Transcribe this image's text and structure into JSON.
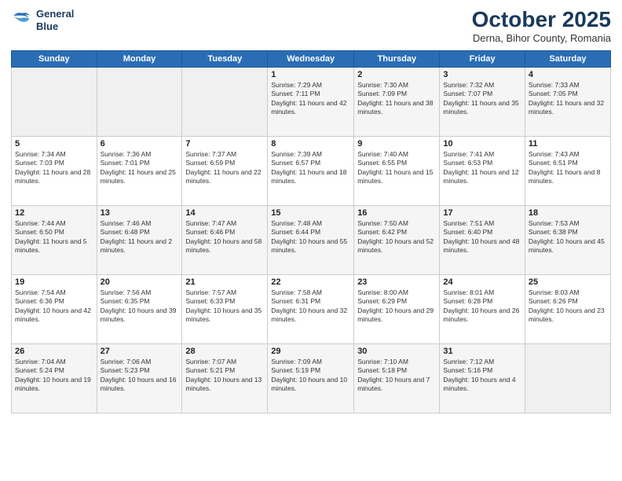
{
  "header": {
    "logo_line1": "General",
    "logo_line2": "Blue",
    "month": "October 2025",
    "location": "Derna, Bihor County, Romania"
  },
  "weekdays": [
    "Sunday",
    "Monday",
    "Tuesday",
    "Wednesday",
    "Thursday",
    "Friday",
    "Saturday"
  ],
  "weeks": [
    [
      {
        "day": "",
        "sunrise": "",
        "sunset": "",
        "daylight": ""
      },
      {
        "day": "",
        "sunrise": "",
        "sunset": "",
        "daylight": ""
      },
      {
        "day": "",
        "sunrise": "",
        "sunset": "",
        "daylight": ""
      },
      {
        "day": "1",
        "sunrise": "Sunrise: 7:29 AM",
        "sunset": "Sunset: 7:11 PM",
        "daylight": "Daylight: 11 hours and 42 minutes."
      },
      {
        "day": "2",
        "sunrise": "Sunrise: 7:30 AM",
        "sunset": "Sunset: 7:09 PM",
        "daylight": "Daylight: 11 hours and 38 minutes."
      },
      {
        "day": "3",
        "sunrise": "Sunrise: 7:32 AM",
        "sunset": "Sunset: 7:07 PM",
        "daylight": "Daylight: 11 hours and 35 minutes."
      },
      {
        "day": "4",
        "sunrise": "Sunrise: 7:33 AM",
        "sunset": "Sunset: 7:05 PM",
        "daylight": "Daylight: 11 hours and 32 minutes."
      }
    ],
    [
      {
        "day": "5",
        "sunrise": "Sunrise: 7:34 AM",
        "sunset": "Sunset: 7:03 PM",
        "daylight": "Daylight: 11 hours and 28 minutes."
      },
      {
        "day": "6",
        "sunrise": "Sunrise: 7:36 AM",
        "sunset": "Sunset: 7:01 PM",
        "daylight": "Daylight: 11 hours and 25 minutes."
      },
      {
        "day": "7",
        "sunrise": "Sunrise: 7:37 AM",
        "sunset": "Sunset: 6:59 PM",
        "daylight": "Daylight: 11 hours and 22 minutes."
      },
      {
        "day": "8",
        "sunrise": "Sunrise: 7:39 AM",
        "sunset": "Sunset: 6:57 PM",
        "daylight": "Daylight: 11 hours and 18 minutes."
      },
      {
        "day": "9",
        "sunrise": "Sunrise: 7:40 AM",
        "sunset": "Sunset: 6:55 PM",
        "daylight": "Daylight: 11 hours and 15 minutes."
      },
      {
        "day": "10",
        "sunrise": "Sunrise: 7:41 AM",
        "sunset": "Sunset: 6:53 PM",
        "daylight": "Daylight: 11 hours and 12 minutes."
      },
      {
        "day": "11",
        "sunrise": "Sunrise: 7:43 AM",
        "sunset": "Sunset: 6:51 PM",
        "daylight": "Daylight: 11 hours and 8 minutes."
      }
    ],
    [
      {
        "day": "12",
        "sunrise": "Sunrise: 7:44 AM",
        "sunset": "Sunset: 6:50 PM",
        "daylight": "Daylight: 11 hours and 5 minutes."
      },
      {
        "day": "13",
        "sunrise": "Sunrise: 7:46 AM",
        "sunset": "Sunset: 6:48 PM",
        "daylight": "Daylight: 11 hours and 2 minutes."
      },
      {
        "day": "14",
        "sunrise": "Sunrise: 7:47 AM",
        "sunset": "Sunset: 6:46 PM",
        "daylight": "Daylight: 10 hours and 58 minutes."
      },
      {
        "day": "15",
        "sunrise": "Sunrise: 7:48 AM",
        "sunset": "Sunset: 6:44 PM",
        "daylight": "Daylight: 10 hours and 55 minutes."
      },
      {
        "day": "16",
        "sunrise": "Sunrise: 7:50 AM",
        "sunset": "Sunset: 6:42 PM",
        "daylight": "Daylight: 10 hours and 52 minutes."
      },
      {
        "day": "17",
        "sunrise": "Sunrise: 7:51 AM",
        "sunset": "Sunset: 6:40 PM",
        "daylight": "Daylight: 10 hours and 48 minutes."
      },
      {
        "day": "18",
        "sunrise": "Sunrise: 7:53 AM",
        "sunset": "Sunset: 6:38 PM",
        "daylight": "Daylight: 10 hours and 45 minutes."
      }
    ],
    [
      {
        "day": "19",
        "sunrise": "Sunrise: 7:54 AM",
        "sunset": "Sunset: 6:36 PM",
        "daylight": "Daylight: 10 hours and 42 minutes."
      },
      {
        "day": "20",
        "sunrise": "Sunrise: 7:56 AM",
        "sunset": "Sunset: 6:35 PM",
        "daylight": "Daylight: 10 hours and 39 minutes."
      },
      {
        "day": "21",
        "sunrise": "Sunrise: 7:57 AM",
        "sunset": "Sunset: 6:33 PM",
        "daylight": "Daylight: 10 hours and 35 minutes."
      },
      {
        "day": "22",
        "sunrise": "Sunrise: 7:58 AM",
        "sunset": "Sunset: 6:31 PM",
        "daylight": "Daylight: 10 hours and 32 minutes."
      },
      {
        "day": "23",
        "sunrise": "Sunrise: 8:00 AM",
        "sunset": "Sunset: 6:29 PM",
        "daylight": "Daylight: 10 hours and 29 minutes."
      },
      {
        "day": "24",
        "sunrise": "Sunrise: 8:01 AM",
        "sunset": "Sunset: 6:28 PM",
        "daylight": "Daylight: 10 hours and 26 minutes."
      },
      {
        "day": "25",
        "sunrise": "Sunrise: 8:03 AM",
        "sunset": "Sunset: 6:26 PM",
        "daylight": "Daylight: 10 hours and 23 minutes."
      }
    ],
    [
      {
        "day": "26",
        "sunrise": "Sunrise: 7:04 AM",
        "sunset": "Sunset: 5:24 PM",
        "daylight": "Daylight: 10 hours and 19 minutes."
      },
      {
        "day": "27",
        "sunrise": "Sunrise: 7:06 AM",
        "sunset": "Sunset: 5:23 PM",
        "daylight": "Daylight: 10 hours and 16 minutes."
      },
      {
        "day": "28",
        "sunrise": "Sunrise: 7:07 AM",
        "sunset": "Sunset: 5:21 PM",
        "daylight": "Daylight: 10 hours and 13 minutes."
      },
      {
        "day": "29",
        "sunrise": "Sunrise: 7:09 AM",
        "sunset": "Sunset: 5:19 PM",
        "daylight": "Daylight: 10 hours and 10 minutes."
      },
      {
        "day": "30",
        "sunrise": "Sunrise: 7:10 AM",
        "sunset": "Sunset: 5:18 PM",
        "daylight": "Daylight: 10 hours and 7 minutes."
      },
      {
        "day": "31",
        "sunrise": "Sunrise: 7:12 AM",
        "sunset": "Sunset: 5:16 PM",
        "daylight": "Daylight: 10 hours and 4 minutes."
      },
      {
        "day": "",
        "sunrise": "",
        "sunset": "",
        "daylight": ""
      }
    ]
  ]
}
